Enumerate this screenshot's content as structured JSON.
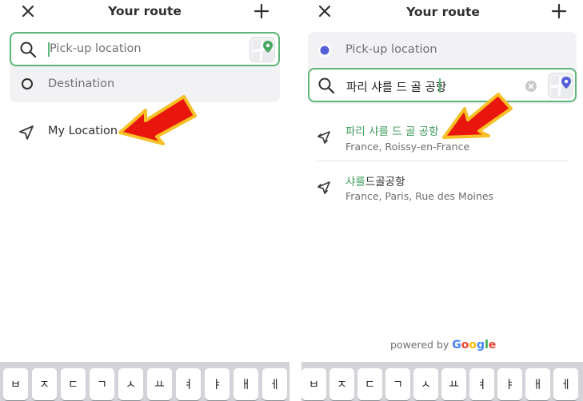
{
  "left": {
    "header": {
      "title": "Your route"
    },
    "pickup": {
      "placeholder": "Pick-up location"
    },
    "destination": {
      "placeholder": "Destination"
    },
    "my_location": {
      "label": "My Location"
    },
    "keyboard": {
      "keys": [
        "ㅂ",
        "ㅈ",
        "ㄷ",
        "ㄱ",
        "ㅅ",
        "ㅛ",
        "ㅕ",
        "ㅑ",
        "ㅐ",
        "ㅔ"
      ]
    }
  },
  "right": {
    "header": {
      "title": "Your route"
    },
    "pickup": {
      "label": "Pick-up location"
    },
    "destination": {
      "value": "파리 샤를 드 골 공항"
    },
    "results": [
      {
        "title_highlight": "파리 샤를 드 골 공항",
        "title_rest": "",
        "subtitle": "France, Roissy-en-France",
        "icon": "plane-icon"
      },
      {
        "title_highlight": "샤를",
        "title_rest": "드골공항",
        "subtitle": "France, Paris, Rue des Moines",
        "icon": "plane-icon"
      }
    ],
    "powered_by": {
      "prefix": "powered by",
      "brand": [
        "G",
        "o",
        "o",
        "g",
        "l",
        "e"
      ]
    },
    "keyboard": {
      "keys": [
        "ㅂ",
        "ㅈ",
        "ㄷ",
        "ㄱ",
        "ㅅ",
        "ㅛ",
        "ㅕ",
        "ㅑ",
        "ㅐ",
        "ㅔ"
      ]
    }
  },
  "colors": {
    "accent_green": "#5fb67a",
    "highlight_green": "#3f9c5d",
    "radio_blue": "#5560d8",
    "arrow_red": "#e8160c",
    "arrow_yellow": "#f6c026"
  }
}
